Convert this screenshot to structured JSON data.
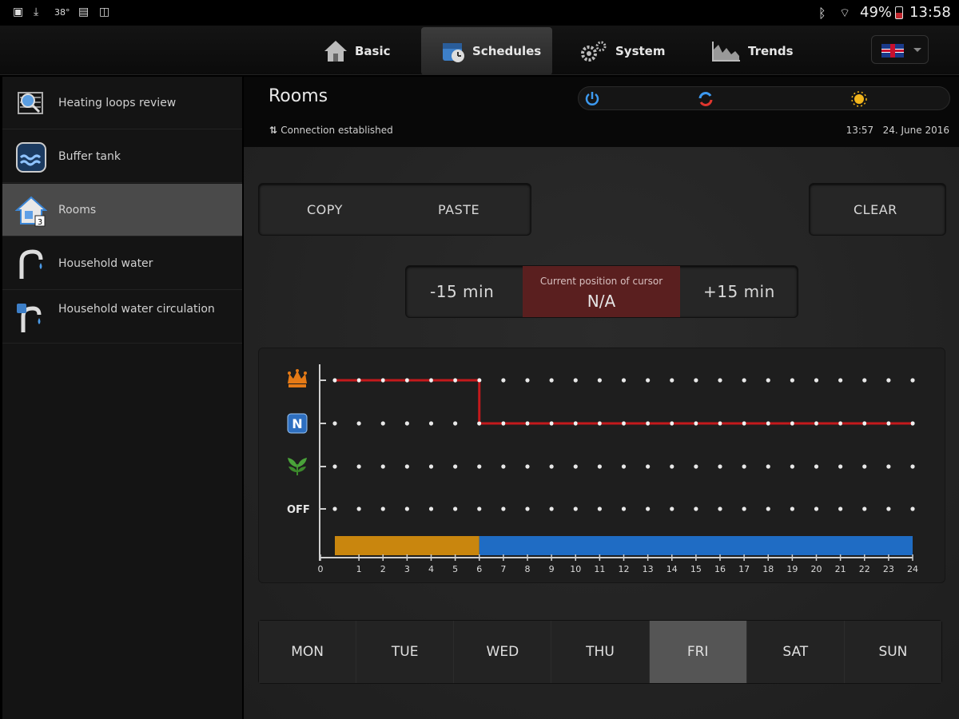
{
  "status_bar": {
    "left_icons": [
      "picture-icon",
      "download-icon",
      "temperature-icon",
      "clipboard-icon",
      "gallery-icon"
    ],
    "temp": "38°",
    "battery": "49%",
    "time": "13:58"
  },
  "nav": {
    "tabs": [
      {
        "label": "Basic",
        "icon": "house-icon"
      },
      {
        "label": "Schedules",
        "icon": "schedule-icon",
        "active": true
      },
      {
        "label": "System",
        "icon": "gears-icon"
      },
      {
        "label": "Trends",
        "icon": "trends-icon"
      }
    ],
    "language_icon": "uk-flag-icon"
  },
  "sidebar": {
    "items": [
      {
        "label": "Heating loops review",
        "icon": "heating-loops-icon"
      },
      {
        "label": "Buffer tank",
        "icon": "buffer-tank-icon"
      },
      {
        "label": "Rooms",
        "icon": "rooms-icon",
        "badge": "3",
        "active": true
      },
      {
        "label": "Household water",
        "icon": "tap-icon"
      },
      {
        "label": "Household water circulation",
        "icon": "circulation-tap-icon"
      }
    ]
  },
  "header": {
    "title": "Rooms",
    "connection": "Connection established",
    "time": "13:57",
    "date": "24. June 2016"
  },
  "toolbar": {
    "copy": "COPY",
    "paste": "PASTE",
    "clear": "CLEAR"
  },
  "cursor": {
    "minus": "-15 min",
    "caption": "Current position of cursor",
    "value": "N/A",
    "plus": "+15 min"
  },
  "chart_data": {
    "type": "line",
    "x_ticks": [
      "0",
      "1",
      "2",
      "3",
      "4",
      "5",
      "6",
      "7",
      "8",
      "9",
      "10",
      "11",
      "12",
      "13",
      "14",
      "15",
      "16",
      "17",
      "18",
      "19",
      "20",
      "21",
      "22",
      "23",
      "24"
    ],
    "xlim": [
      0,
      24
    ],
    "levels": [
      "comfort",
      "normal",
      "eco",
      "OFF"
    ],
    "level_labels": {
      "off": "OFF",
      "normal": "N"
    },
    "schedule": [
      {
        "from": 0,
        "to": 6,
        "level": "comfort"
      },
      {
        "from": 6,
        "to": 24,
        "level": "normal"
      }
    ],
    "bar_segments": [
      {
        "from": 0,
        "to": 6,
        "color": "#c9860e"
      },
      {
        "from": 6,
        "to": 24,
        "color": "#1f6cc4"
      }
    ],
    "line_color": "#c4191c"
  },
  "days": [
    "MON",
    "TUE",
    "WED",
    "THU",
    "FRI",
    "SAT",
    "SUN"
  ],
  "active_day": "FRI",
  "colors": {
    "accent_red": "#c4191c",
    "comfort_orange": "#c9860e",
    "normal_blue": "#1f6cc4",
    "active_gray": "#555555"
  }
}
